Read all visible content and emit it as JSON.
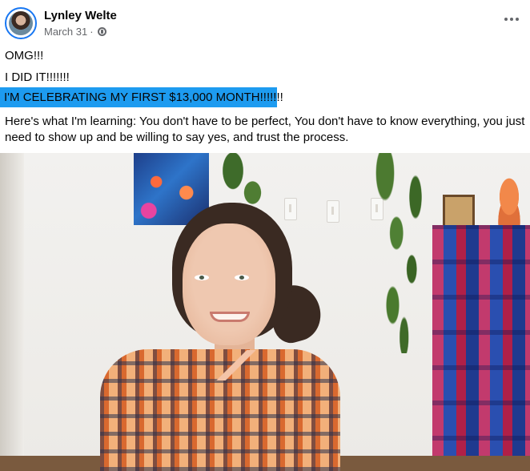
{
  "post": {
    "author": "Lynley Welte",
    "date": "March 31",
    "separator": "·",
    "privacy_icon": "globe-icon",
    "more_icon": "more-options-icon",
    "lines": [
      "OMG!!!",
      "I DID IT!!!!!!!",
      "I'M CELEBRATING MY FIRST $13,000 MONTH!!!!!!!"
    ],
    "paragraph": "Here's what I'm learning: You don't have to be perfect, You don't have to know everything, you just need to show up and be willing to say yes, and trust the process."
  },
  "colors": {
    "highlight": "#1d9bf0",
    "text": "#050505",
    "meta": "#65676b"
  }
}
